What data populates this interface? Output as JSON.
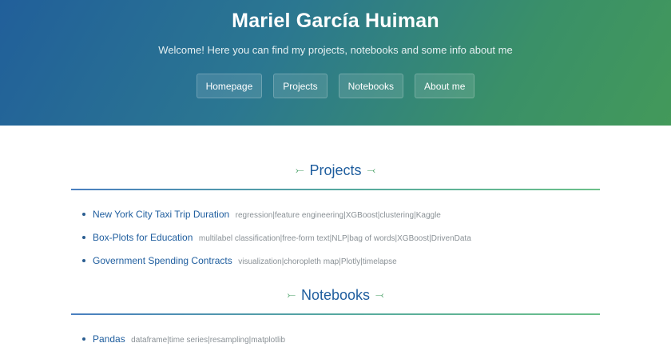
{
  "header": {
    "title": "Mariel García Huiman",
    "tagline": "Welcome! Here you can find my projects, notebooks and some info about me",
    "nav": [
      "Homepage",
      "Projects",
      "Notebooks",
      "About me"
    ],
    "gradient_colors": [
      "#215f9a",
      "#43995a"
    ]
  },
  "sections": {
    "projects": {
      "heading": "Projects",
      "items": [
        {
          "title": "New York City Taxi Trip Duration",
          "tags": "regression|feature engineering|XGBoost|clustering|Kaggle"
        },
        {
          "title": "Box-Plots for Education",
          "tags": "multilabel classification|free-form text|NLP|bag of words|XGBoost|DrivenData"
        },
        {
          "title": "Government Spending Contracts",
          "tags": "visualization|choropleth map|Plotly|timelapse"
        }
      ]
    },
    "notebooks": {
      "heading": "Notebooks",
      "items": [
        {
          "title": "Pandas",
          "tags": "dataframe|time series|resampling|matplotlib"
        }
      ]
    }
  },
  "colors": {
    "link": "#1e5d9e",
    "tags": "#8a9196",
    "heading_decoration": "#3d9a5d"
  },
  "icons": {
    "heading_decoration": "arrow-ornament-icon"
  }
}
